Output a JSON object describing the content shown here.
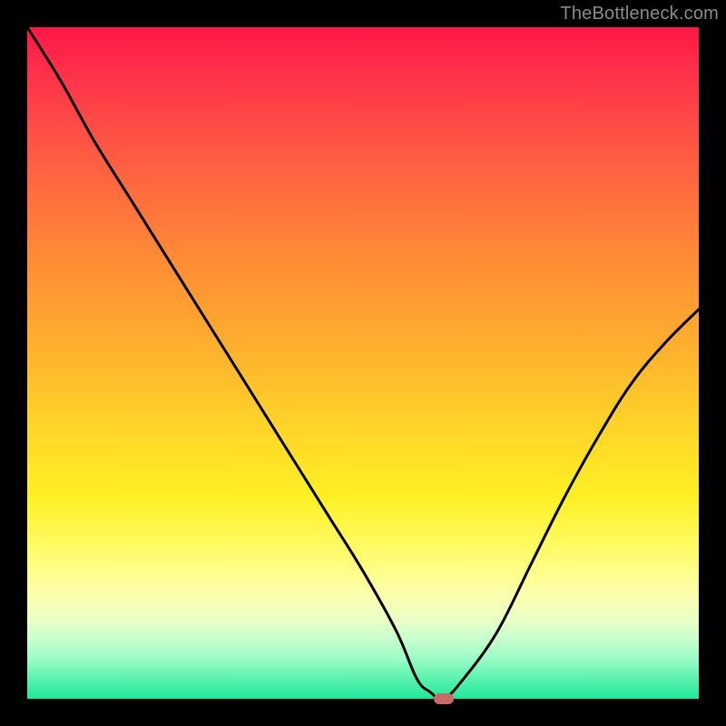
{
  "watermark": "TheBottleneck.com",
  "chart_data": {
    "type": "line",
    "title": "",
    "xlabel": "",
    "ylabel": "",
    "xlim": [
      0,
      100
    ],
    "ylim": [
      0,
      100
    ],
    "grid": false,
    "legend": null,
    "series": [
      {
        "name": "bottleneck-curve",
        "x": [
          0,
          5,
          10,
          15,
          20,
          25,
          30,
          35,
          40,
          45,
          50,
          55,
          58,
          60,
          62,
          65,
          70,
          75,
          80,
          85,
          90,
          95,
          100
        ],
        "values": [
          100,
          92,
          83,
          75,
          67,
          59,
          51,
          43,
          35,
          27,
          19,
          10,
          3,
          1,
          0,
          3,
          10,
          20,
          30,
          39,
          47,
          53,
          58
        ]
      }
    ],
    "marker": {
      "x": 62,
      "y": 0,
      "color": "#c96a6a"
    },
    "background_gradient": {
      "top": "#ff1746",
      "middle": "#ffd029",
      "bottom": "#1fe899"
    }
  }
}
